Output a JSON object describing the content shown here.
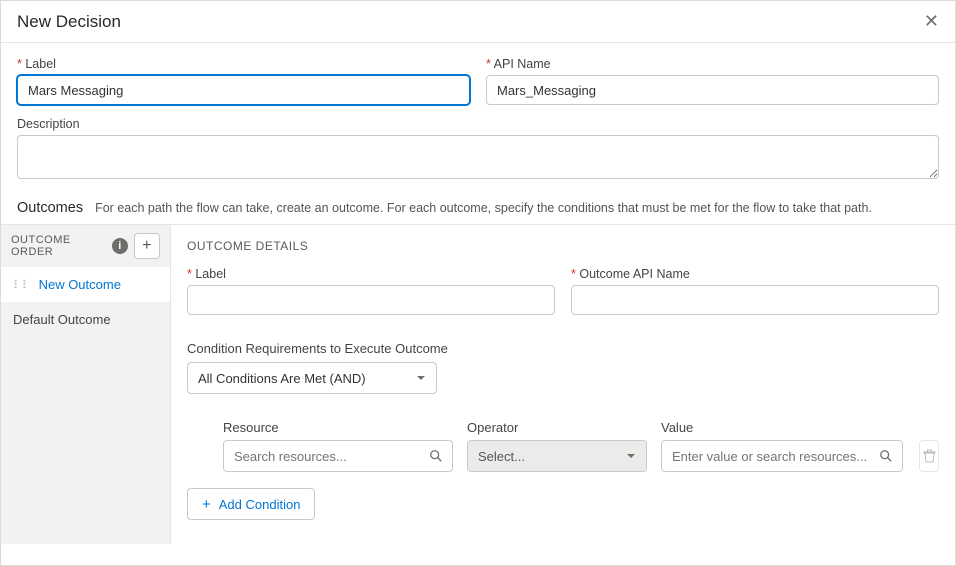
{
  "header": {
    "title": "New Decision"
  },
  "form": {
    "label_label": "Label",
    "label_value": "Mars Messaging",
    "api_label": "API Name",
    "api_value": "Mars_Messaging",
    "desc_label": "Description",
    "desc_value": ""
  },
  "outcomes_header": {
    "title": "Outcomes",
    "help": "For each path the flow can take, create an outcome. For each outcome, specify the conditions that must be met for the flow to take that path."
  },
  "sidebar": {
    "order_label_1": "OUTCOME",
    "order_label_2": "ORDER",
    "items": [
      {
        "label": "New Outcome"
      },
      {
        "label": "Default Outcome"
      }
    ]
  },
  "details": {
    "section_title": "OUTCOME DETAILS",
    "label_label": "Label",
    "label_value": "",
    "api_label": "Outcome API Name",
    "api_value": "",
    "cond_title": "Condition Requirements to Execute Outcome",
    "cond_selected": "All Conditions Are Met (AND)",
    "resource_label": "Resource",
    "resource_placeholder": "Search resources...",
    "operator_label": "Operator",
    "operator_placeholder": "Select...",
    "value_label": "Value",
    "value_placeholder": "Enter value or search resources...",
    "add_cond": "Add Condition"
  }
}
